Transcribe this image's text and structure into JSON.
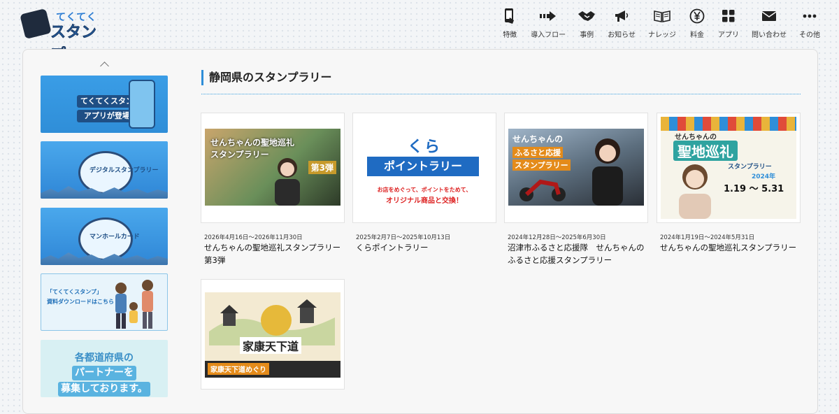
{
  "logo": {
    "line1": "てくてく",
    "line2": "スタンプ"
  },
  "nav": [
    {
      "label": "特徴",
      "icon": "phone-hand-icon"
    },
    {
      "label": "導入フロー",
      "icon": "flow-arrow-icon"
    },
    {
      "label": "事例",
      "icon": "handshake-icon"
    },
    {
      "label": "お知らせ",
      "icon": "megaphone-icon"
    },
    {
      "label": "ナレッジ",
      "icon": "book-icon"
    },
    {
      "label": "料金",
      "icon": "yen-icon"
    },
    {
      "label": "アプリ",
      "icon": "apps-grid-icon"
    },
    {
      "label": "問い合わせ",
      "icon": "mail-icon"
    },
    {
      "label": "その他",
      "icon": "more-dots-icon"
    }
  ],
  "sidebar": {
    "banners": [
      {
        "text1": "てくてくスタンプ",
        "text2": "アプリが登場！"
      },
      {
        "text": "デジタルスタンプラリー"
      },
      {
        "text": "マンホールカード"
      },
      {
        "text1": "「てくてくスタンプ」",
        "text2": "資料ダウンロードはこちら"
      },
      {
        "text1": "各都道府県の",
        "text2": "パートナーを",
        "text3": "募集しております。"
      }
    ]
  },
  "section": {
    "title": "静岡県のスタンプラリー"
  },
  "cards": [
    {
      "date": "2026年4月16日〜2026年11月30日",
      "title": "せんちゃんの聖地巡礼スタンプラリー第3弾",
      "art_text": "せんちゃんの聖地巡礼スタンプラリー",
      "art_badge": "第3弾"
    },
    {
      "date": "2025年2月7日〜2025年10月13日",
      "title": "くらポイントラリー",
      "art_logo": "くら",
      "art_text": "ポイントラリー",
      "art_sub1": "お店をめぐって、ポイントをためて、",
      "art_sub2": "オリジナル商品と交換！"
    },
    {
      "date": "2024年12月28日〜2025年6月30日",
      "title": "沼津市ふるさと応援隊　せんちゃんのふるさと応援スタンプラリー",
      "art_text1": "せんちゃんの",
      "art_text2": "ふるさと応援",
      "art_text3": "スタンプラリー"
    },
    {
      "date": "2024年1月19日〜2024年5月31日",
      "title": "せんちゃんの聖地巡礼スタンプラリー",
      "art_text1": "せんちゃんの",
      "art_text2": "聖地巡礼",
      "art_text3": "スタンプラリー",
      "art_year": "2024年",
      "art_dates": "1.19 ～ 5.31"
    },
    {
      "date": "",
      "title": "",
      "art_text": "家康天下道",
      "art_sub": "家康天下道めぐり"
    }
  ],
  "colors": {
    "accent": "#2f8ed8",
    "nav_text": "#333333",
    "kura_blue": "#1f6bc2",
    "kura_red": "#dd2222"
  }
}
